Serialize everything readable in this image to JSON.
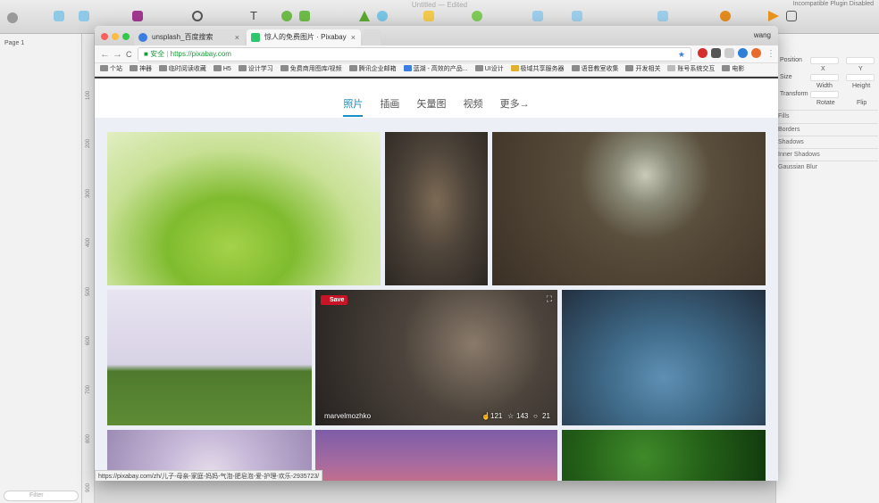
{
  "sketch": {
    "doc_title": "Untitled — Edited",
    "plugin_note": "Incompatible Plugin Disabled",
    "page_selector": "Page 1",
    "filter_placeholder": "Filter",
    "ruler_marks": [
      "100",
      "200",
      "300",
      "400",
      "500",
      "600",
      "700",
      "800",
      "900"
    ],
    "inspector": {
      "position": "Position",
      "x": "X",
      "y": "Y",
      "size": "Size",
      "width": "Width",
      "height": "Height",
      "transform": "Transform",
      "rotate": "Rotate",
      "flip": "Flip",
      "sections": [
        "Fills",
        "Borders",
        "Shadows",
        "Inner Shadows",
        "Gaussian Blur"
      ]
    }
  },
  "browser": {
    "tabs": [
      {
        "title": "unsplash_百度搜索",
        "close": "×",
        "active": false
      },
      {
        "title": "惊人的免费图片 · Pixabay",
        "close": "×",
        "active": true
      }
    ],
    "profile": "wang",
    "nav": {
      "back": "←",
      "forward": "→",
      "reload": "C"
    },
    "secure_label": "安全",
    "url": "https://pixabay.com",
    "bookmarks": [
      "个站",
      "神器",
      "临时阅读收藏",
      "H5",
      "设计学习",
      "免费商用图库/视频",
      "腾讯企业邮箱",
      "蓝湖 - 高效的产品...",
      "UI设计",
      "极域共享服务器",
      "语音教室收集",
      "开发相关",
      "账号系统交互",
      "电影"
    ],
    "status_url": "https://pixabay.com/zh/儿子-母亲-家庭-妈妈-气泡-肥皂泡-爱-护理-欢乐-2935723/"
  },
  "page": {
    "tabs": [
      "照片",
      "插画",
      "矢量图",
      "视频",
      "更多→"
    ],
    "active_tab": 0,
    "hover_card": {
      "save_label": "Save",
      "author": "marvelmozhko",
      "likes": "121",
      "favorites": "143",
      "comments": "21"
    }
  },
  "colors": {
    "active_tab": "#1a8dc5",
    "pin_red": "#c71426"
  }
}
